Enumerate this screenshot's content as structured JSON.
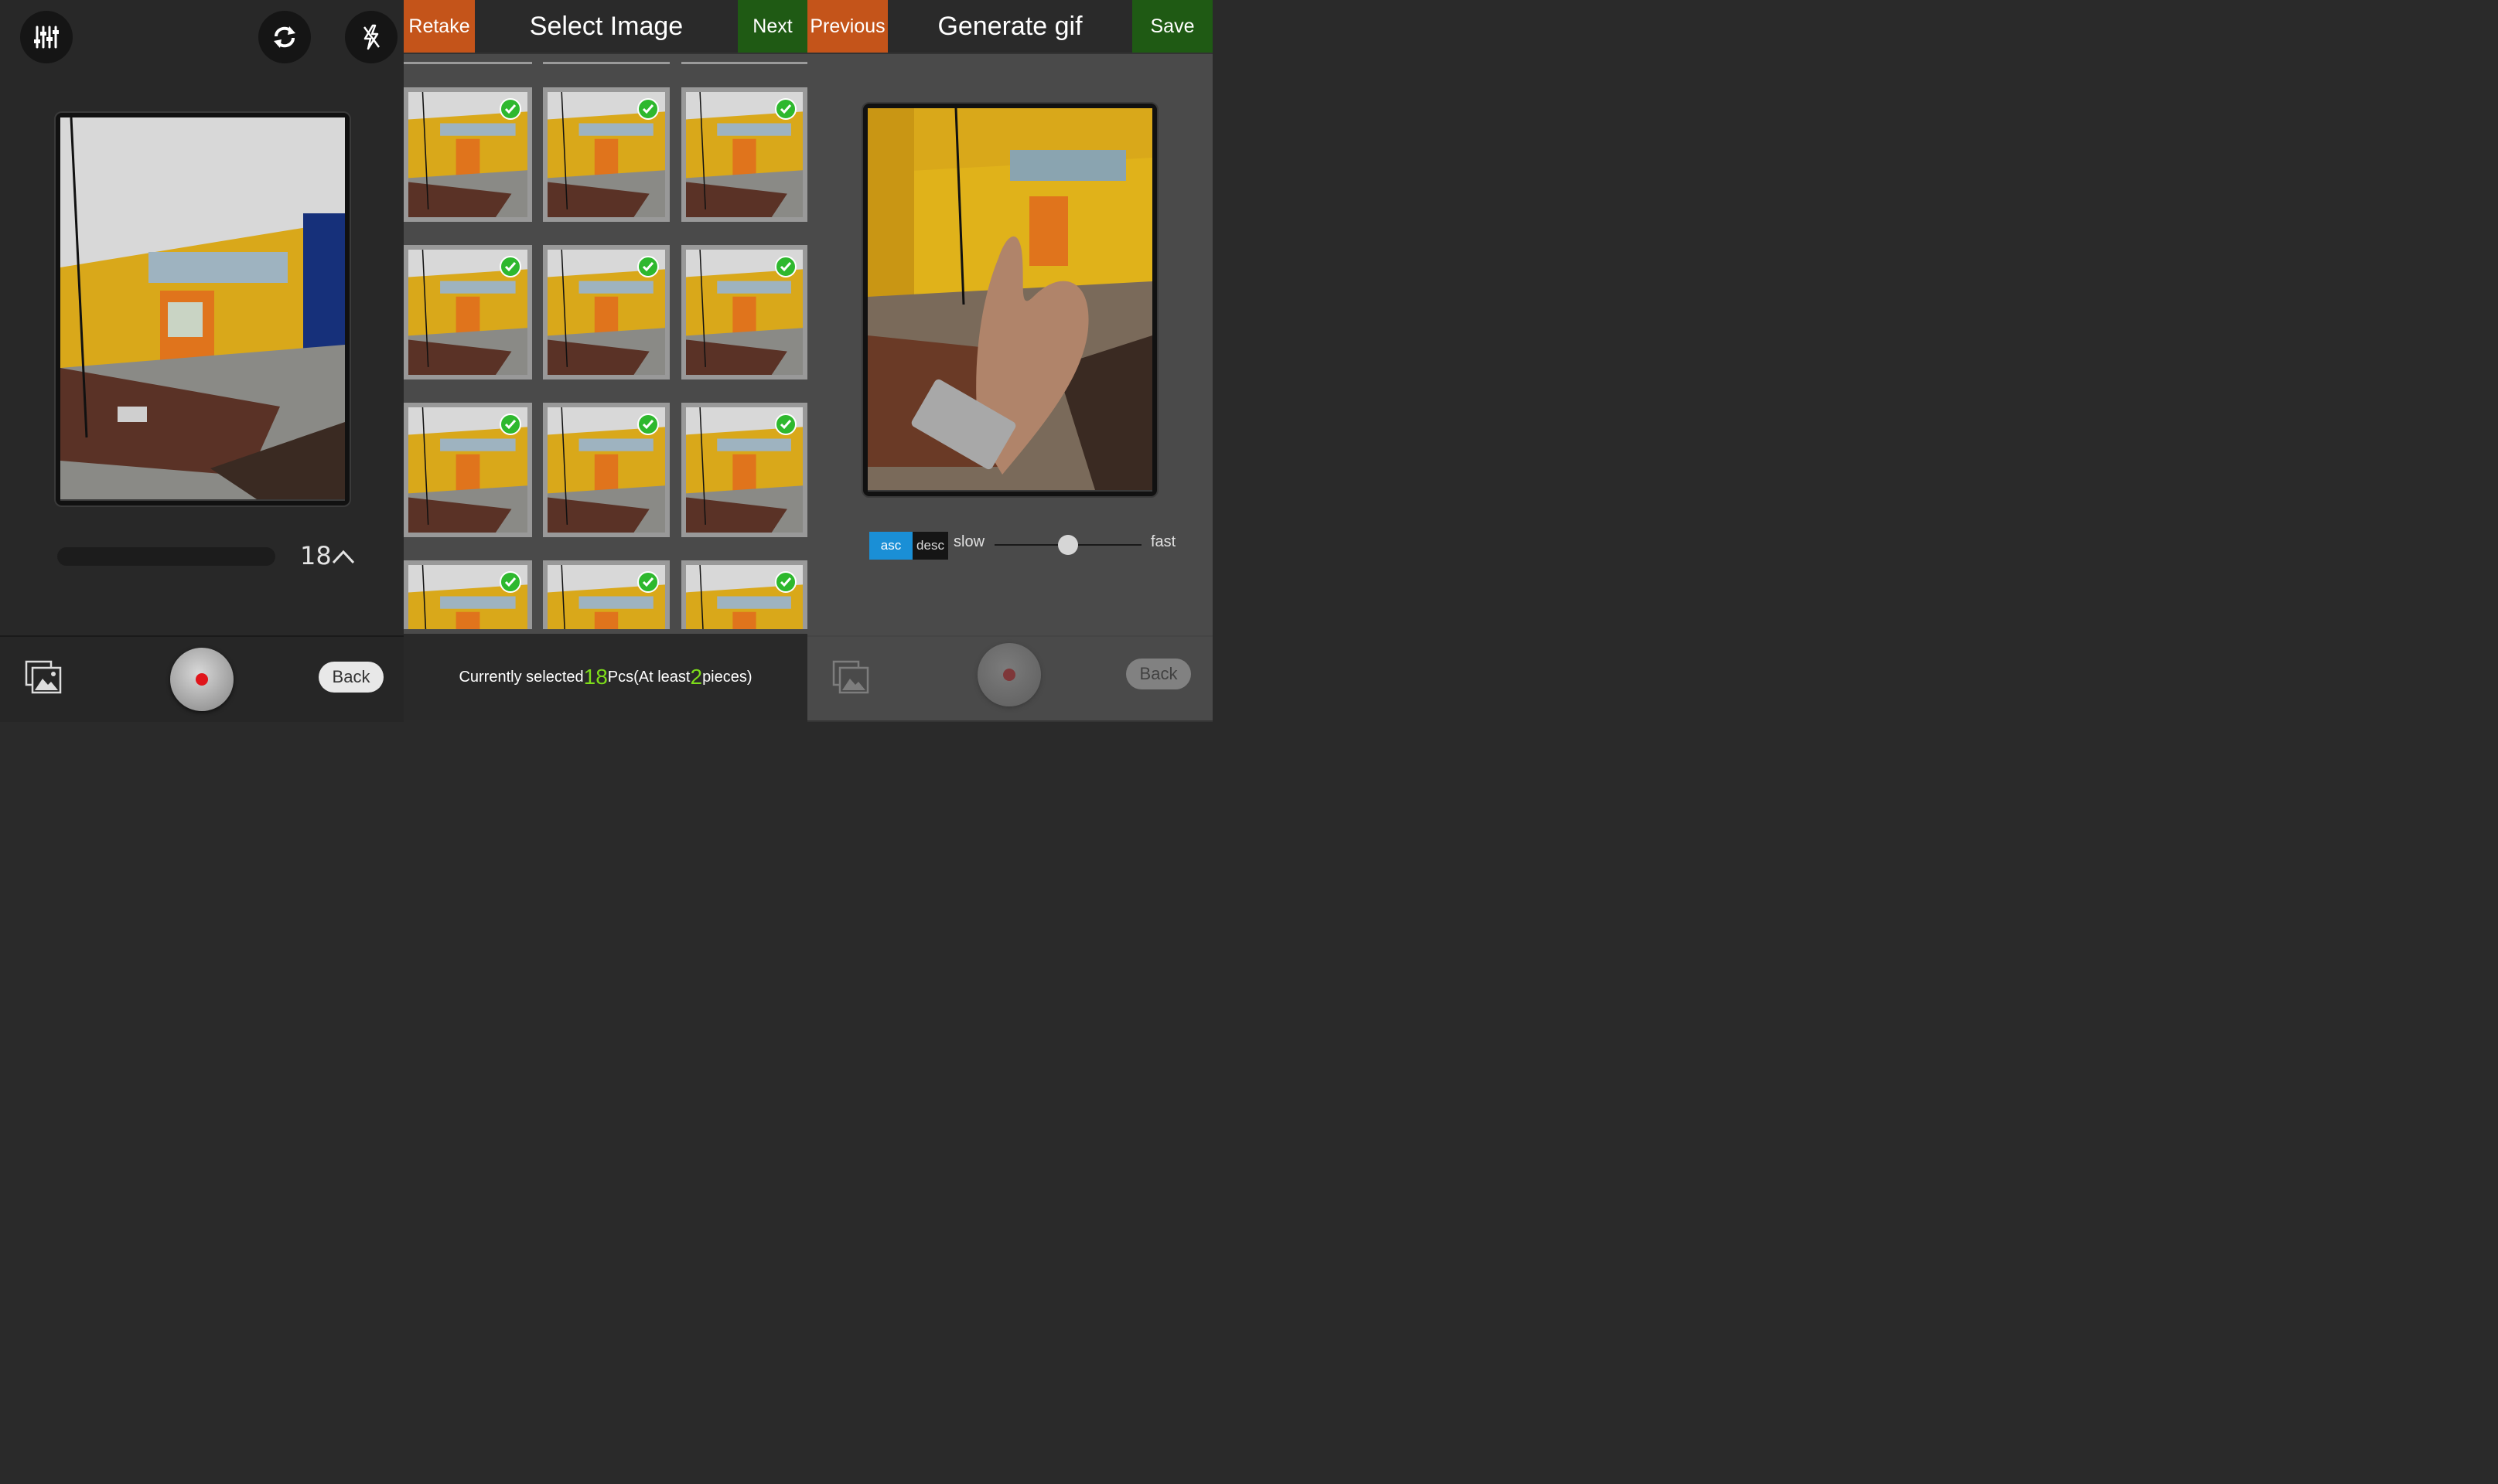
{
  "left": {
    "icons": {
      "settings": "equalizer-icon",
      "switch_camera": "switch-camera-icon",
      "flash": "flash-off-icon",
      "gallery": "gallery-icon"
    },
    "count": "18",
    "back_label": "Back"
  },
  "middle": {
    "retake_label": "Retake",
    "title": "Select Image",
    "next_label": "Next",
    "status_prefix": "Currently selected",
    "selected_count": "18",
    "status_mid": "Pcs(At least",
    "min_count": "2",
    "status_suffix": "pieces)"
  },
  "right": {
    "previous_label": "Previous",
    "title": "Generate gif",
    "save_label": "Save",
    "asc_label": "asc",
    "desc_label": "desc",
    "slow_label": "slow",
    "fast_label": "fast",
    "speed_value": 0.5,
    "back_label": "Back"
  },
  "colors": {
    "orange_button": "#c4541a",
    "green_button": "#1f5a14",
    "asc_active": "#1a8fd6",
    "highlight": "#7ddc1a",
    "check": "#2eb82e"
  }
}
